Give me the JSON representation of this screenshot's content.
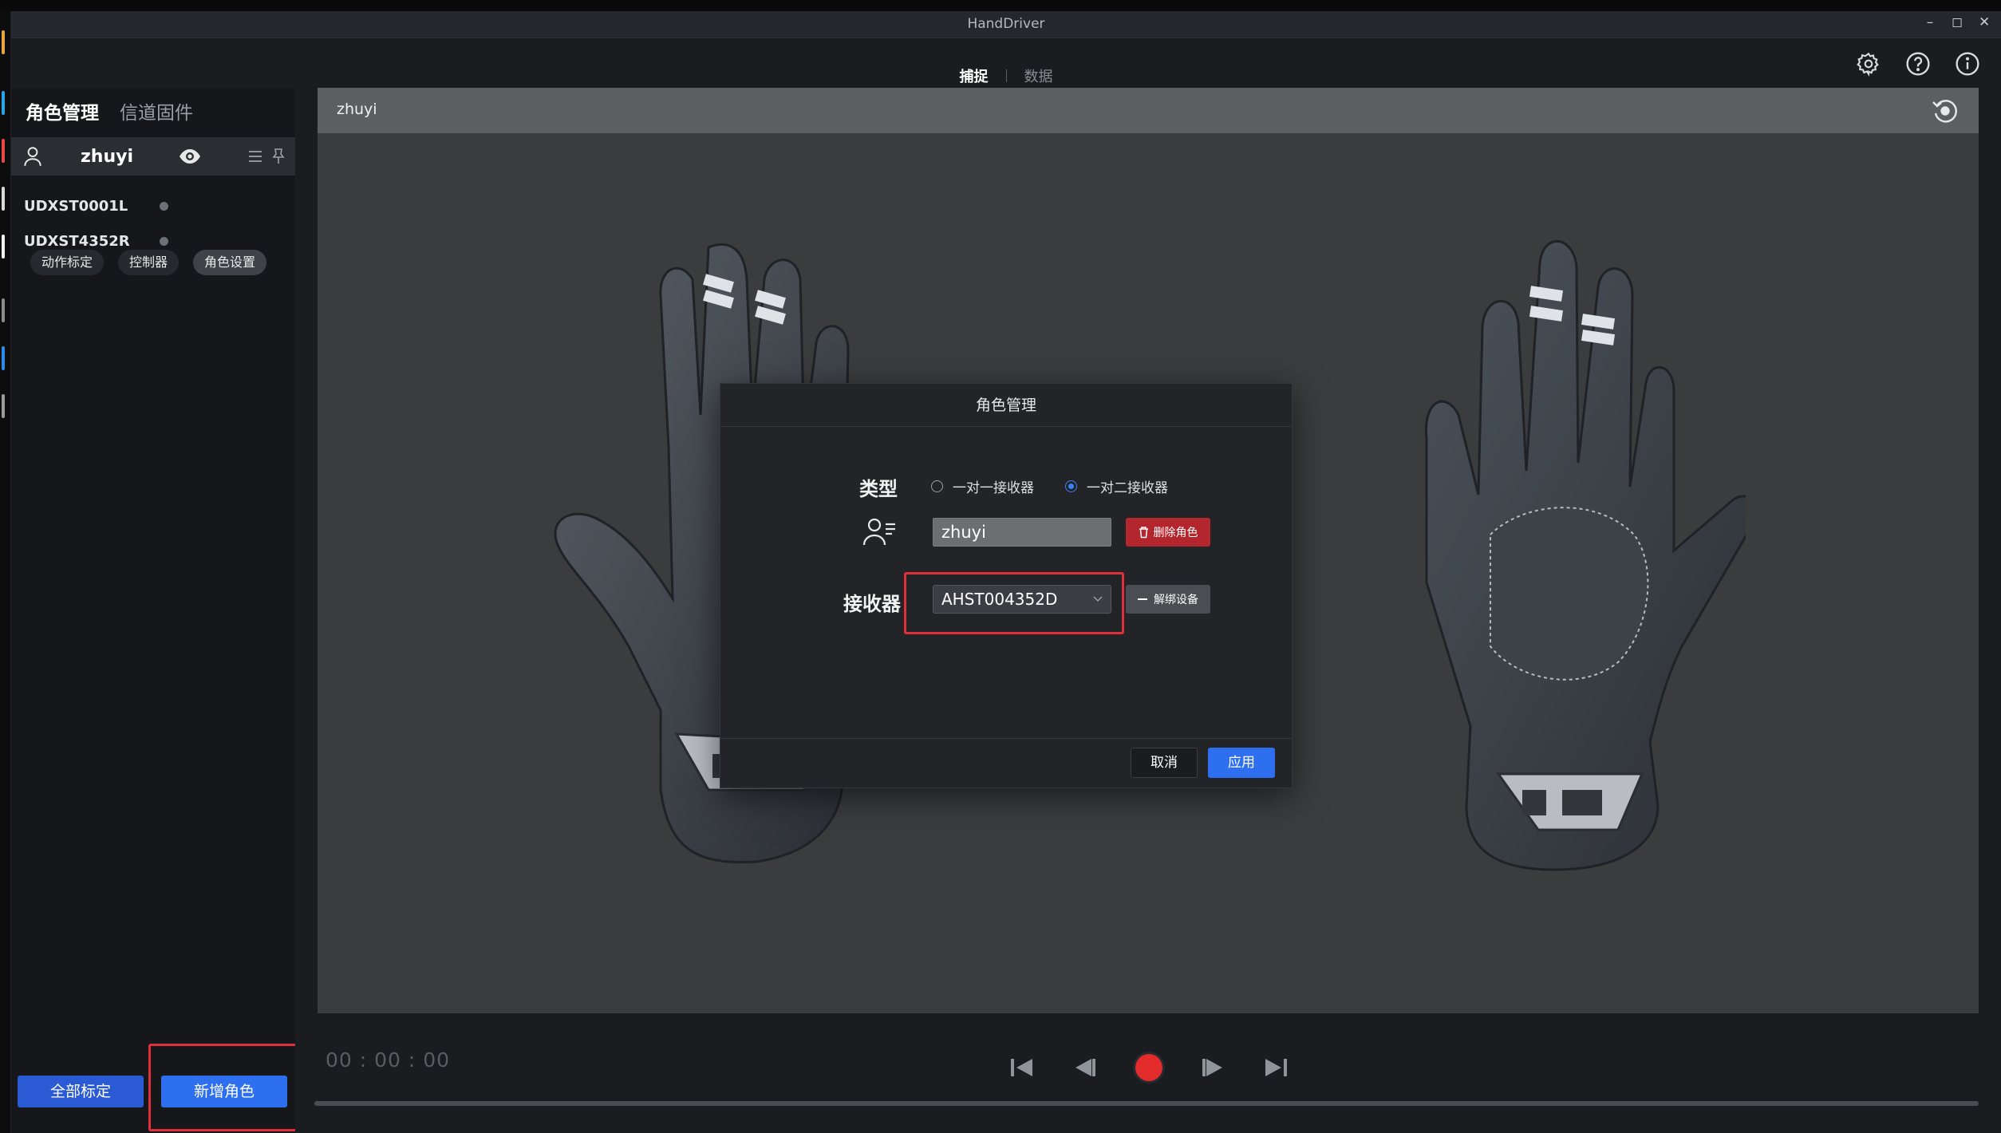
{
  "window": {
    "title": "HandDriver",
    "controls": [
      "–",
      "◻",
      "✕"
    ]
  },
  "topbar": {
    "tabs": [
      {
        "label": "捕捉",
        "active": true
      },
      {
        "label": "数据",
        "active": false
      }
    ],
    "icons": [
      "settings-icon",
      "help-icon",
      "info-icon"
    ]
  },
  "sidebar": {
    "tabs": [
      {
        "label": "角色管理",
        "active": true
      },
      {
        "label": "信道固件",
        "active": false
      }
    ],
    "role": {
      "name": "zhuyi"
    },
    "devices": [
      {
        "id": "UDXST0001L"
      },
      {
        "id": "UDXST4352R"
      }
    ],
    "pills": [
      {
        "label": "动作标定"
      },
      {
        "label": "控制器"
      },
      {
        "label": "角色设置",
        "active": true
      }
    ],
    "calibrate_all_label": "全部标定",
    "new_role_label": "新增角色"
  },
  "viewport": {
    "title": "zhuyi"
  },
  "dialog": {
    "title": "角色管理",
    "type_label": "类型",
    "radio_options": [
      {
        "label": "一对一接收器",
        "selected": false
      },
      {
        "label": "一对二接收器",
        "selected": true
      }
    ],
    "name_value": "zhuyi",
    "delete_label": "删除角色",
    "receiver_label": "接收器",
    "receiver_value": "AHST004352D",
    "unbind_label": "解绑设备",
    "cancel_label": "取消",
    "apply_label": "应用"
  },
  "playback": {
    "timecode": "00 : 00 : 00"
  },
  "colors": {
    "accent": "#2e6ff0",
    "danger": "#b3262d",
    "record": "#e32b2b",
    "highlight": "#e0303a"
  }
}
